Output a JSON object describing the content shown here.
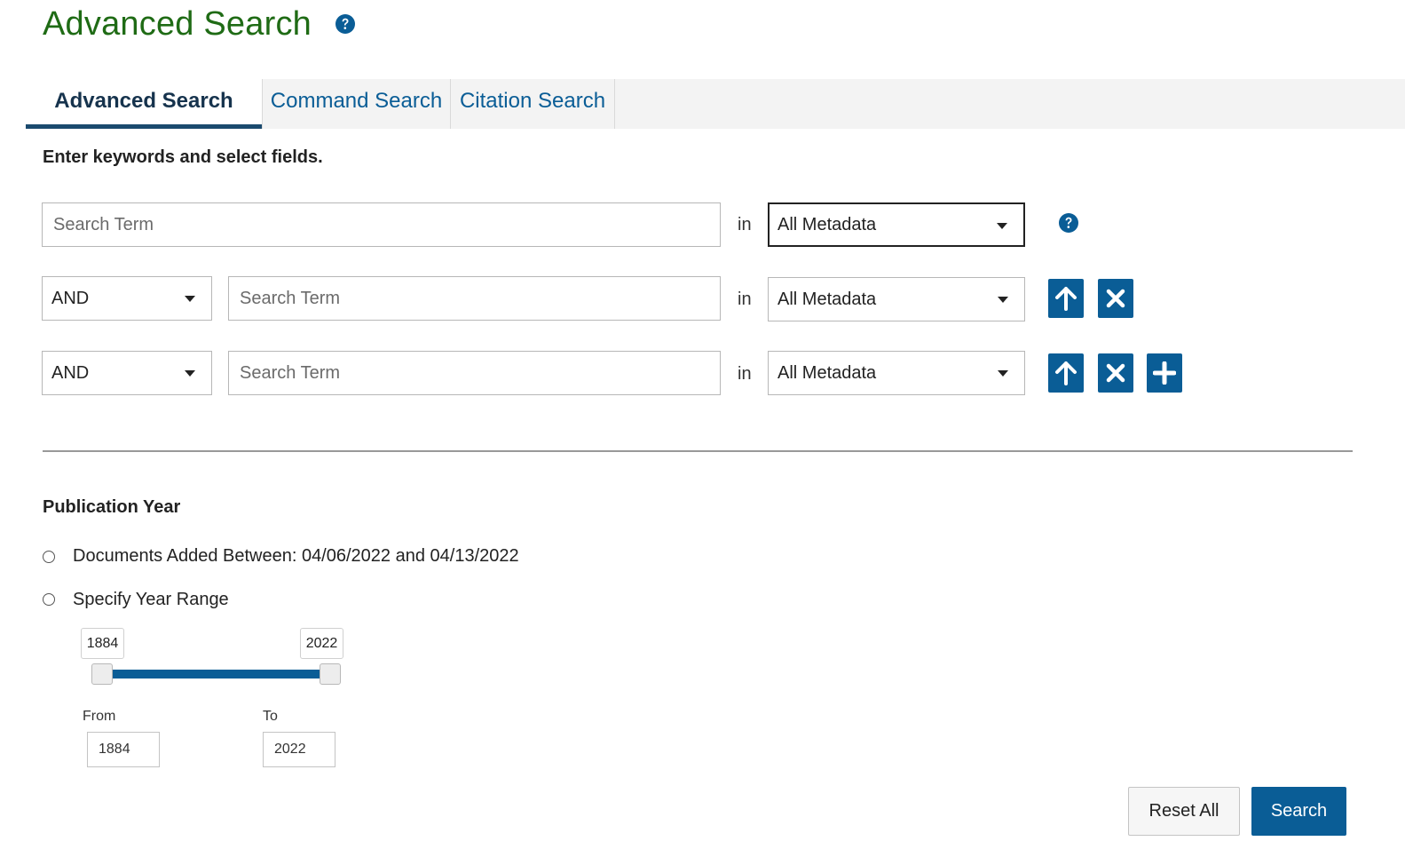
{
  "header": {
    "title": "Advanced Search",
    "help_icon": "question-circle-icon"
  },
  "tabs": [
    {
      "label": "Advanced Search",
      "active": true
    },
    {
      "label": "Command Search",
      "active": false
    },
    {
      "label": "Citation Search",
      "active": false
    }
  ],
  "instructions": "Enter keywords and select fields.",
  "search_rows": [
    {
      "operator": null,
      "term_placeholder": "Search Term",
      "term_value": "",
      "in_label": "in",
      "field": "All Metadata",
      "actions": [
        "help"
      ]
    },
    {
      "operator": "AND",
      "term_placeholder": "Search Term",
      "term_value": "",
      "in_label": "in",
      "field": "All Metadata",
      "actions": [
        "move-up",
        "remove"
      ]
    },
    {
      "operator": "AND",
      "term_placeholder": "Search Term",
      "term_value": "",
      "in_label": "in",
      "field": "All Metadata",
      "actions": [
        "move-up",
        "remove",
        "add"
      ]
    }
  ],
  "publication_year": {
    "title": "Publication Year",
    "options": [
      {
        "label": "Documents Added Between: 04/06/2022 and 04/13/2022",
        "selected": false
      },
      {
        "label": "Specify Year Range",
        "selected": false
      }
    ],
    "slider": {
      "min": 1884,
      "max": 2022,
      "low": "1884",
      "high": "2022"
    },
    "from_label": "From",
    "to_label": "To",
    "from_value": "1884",
    "to_value": "2022"
  },
  "buttons": {
    "reset": "Reset All",
    "search": "Search"
  },
  "colors": {
    "title_green": "#1f6b15",
    "accent_blue": "#0a5d96",
    "tab_active_text": "#16334d"
  }
}
